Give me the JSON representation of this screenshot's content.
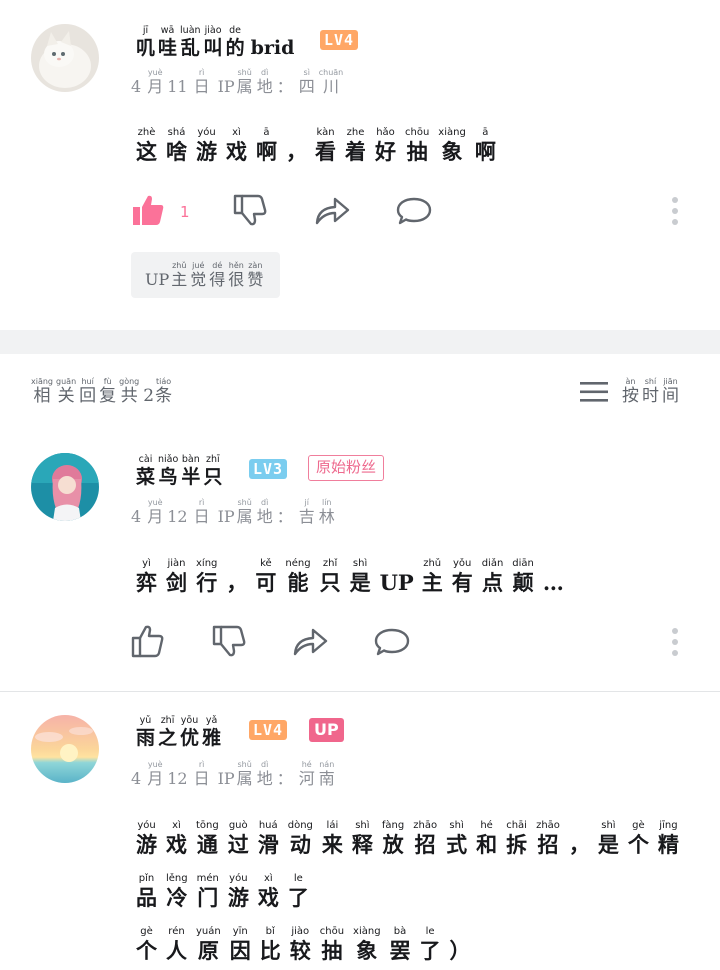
{
  "comment1": {
    "username": {
      "chars": [
        {
          "py": "jī",
          "hz": "叽"
        },
        {
          "py": "wā",
          "hz": "哇"
        },
        {
          "py": "luàn",
          "hz": "乱"
        },
        {
          "py": "jiào",
          "hz": "叫"
        },
        {
          "py": "de",
          "hz": "的"
        }
      ],
      "suffix": "brid"
    },
    "level": "LV4",
    "level_color": "#ff9f5f",
    "meta": {
      "month": [
        {
          "py": "",
          "hz": "4"
        },
        {
          "py": "yuè",
          "hz": "月"
        },
        {
          "py": "",
          "hz": "11"
        },
        {
          "py": "rì",
          "hz": "日"
        }
      ],
      "ip": "IP",
      "loc": [
        {
          "py": "shǔ",
          "hz": "属"
        },
        {
          "py": "dì",
          "hz": "地"
        },
        {
          "py": "",
          "hz": "："
        },
        {
          "py": "sì",
          "hz": "四"
        },
        {
          "py": "chuān",
          "hz": "川"
        }
      ]
    },
    "content": [
      {
        "py": "zhè",
        "hz": "这"
      },
      {
        "py": "shá",
        "hz": "啥"
      },
      {
        "py": "yóu",
        "hz": "游"
      },
      {
        "py": "xì",
        "hz": "戏"
      },
      {
        "py": "ā",
        "hz": "啊"
      },
      {
        "py": "",
        "hz": "，"
      },
      {
        "py": "kàn",
        "hz": "看"
      },
      {
        "py": "zhe",
        "hz": "着"
      },
      {
        "py": "hǎo",
        "hz": "好"
      },
      {
        "py": "chōu",
        "hz": "抽"
      },
      {
        "py": "xiàng",
        "hz": "象"
      },
      {
        "py": "ā",
        "hz": "啊"
      }
    ],
    "like_count": "1",
    "up_liked": {
      "prefix": "UP",
      "chars": [
        {
          "py": "zhǔ",
          "hz": "主"
        },
        {
          "py": "jué",
          "hz": "觉"
        },
        {
          "py": "dé",
          "hz": "得"
        },
        {
          "py": "hěn",
          "hz": "很"
        },
        {
          "py": "zàn",
          "hz": "赞"
        }
      ]
    }
  },
  "replies_header": {
    "count_label": [
      {
        "py": "xiāng",
        "hz": "相"
      },
      {
        "py": "guān",
        "hz": "关"
      },
      {
        "py": "huí",
        "hz": "回"
      },
      {
        "py": "fù",
        "hz": "复"
      },
      {
        "py": "gòng",
        "hz": "共"
      },
      {
        "py": "",
        "hz": "2"
      },
      {
        "py": "tiáo",
        "hz": "条"
      }
    ],
    "sort_label": [
      {
        "py": "àn",
        "hz": "按"
      },
      {
        "py": "shí",
        "hz": "时"
      },
      {
        "py": "jiān",
        "hz": "间"
      }
    ],
    "sort_icon": "list-icon"
  },
  "reply1": {
    "username": {
      "chars": [
        {
          "py": "cài",
          "hz": "菜"
        },
        {
          "py": "niǎo",
          "hz": "鸟"
        },
        {
          "py": "bàn",
          "hz": "半"
        },
        {
          "py": "zhī",
          "hz": "只"
        }
      ]
    },
    "level": "LV3",
    "level_color": "#7bcdef",
    "fan_badge": "原始粉丝",
    "meta": {
      "month": [
        {
          "py": "",
          "hz": "4"
        },
        {
          "py": "yuè",
          "hz": "月"
        },
        {
          "py": "",
          "hz": "12"
        },
        {
          "py": "rì",
          "hz": "日"
        }
      ],
      "ip": "IP",
      "loc": [
        {
          "py": "shǔ",
          "hz": "属"
        },
        {
          "py": "dì",
          "hz": "地"
        },
        {
          "py": "",
          "hz": "："
        },
        {
          "py": "jí",
          "hz": "吉"
        },
        {
          "py": "lín",
          "hz": "林"
        }
      ]
    },
    "content": [
      {
        "py": "yì",
        "hz": "弈"
      },
      {
        "py": "jiàn",
        "hz": "剑"
      },
      {
        "py": "xíng",
        "hz": "行"
      },
      {
        "py": "",
        "hz": "，"
      },
      {
        "py": "kě",
        "hz": "可"
      },
      {
        "py": "néng",
        "hz": "能"
      },
      {
        "py": "zhǐ",
        "hz": "只"
      },
      {
        "py": "shì",
        "hz": "是"
      },
      {
        "py": "",
        "hz": "UP"
      },
      {
        "py": "zhǔ",
        "hz": "主"
      },
      {
        "py": "yǒu",
        "hz": "有"
      },
      {
        "py": "diǎn",
        "hz": "点"
      },
      {
        "py": "diān",
        "hz": "颠"
      },
      {
        "py": "",
        "hz": "…"
      }
    ]
  },
  "reply2": {
    "username": {
      "chars": [
        {
          "py": "yǔ",
          "hz": "雨"
        },
        {
          "py": "zhī",
          "hz": "之"
        },
        {
          "py": "yōu",
          "hz": "优"
        },
        {
          "py": "yǎ",
          "hz": "雅"
        }
      ]
    },
    "level": "LV4",
    "level_color": "#ff9f5f",
    "up_badge": "UP",
    "meta": {
      "month": [
        {
          "py": "",
          "hz": "4"
        },
        {
          "py": "yuè",
          "hz": "月"
        },
        {
          "py": "",
          "hz": "12"
        },
        {
          "py": "rì",
          "hz": "日"
        }
      ],
      "ip": "IP",
      "loc": [
        {
          "py": "shǔ",
          "hz": "属"
        },
        {
          "py": "dì",
          "hz": "地"
        },
        {
          "py": "",
          "hz": "："
        },
        {
          "py": "hé",
          "hz": "河"
        },
        {
          "py": "nán",
          "hz": "南"
        }
      ]
    },
    "content_lines": [
      [
        {
          "py": "yóu",
          "hz": "游"
        },
        {
          "py": "xì",
          "hz": "戏"
        },
        {
          "py": "tōng",
          "hz": "通"
        },
        {
          "py": "guò",
          "hz": "过"
        },
        {
          "py": "huá",
          "hz": "滑"
        },
        {
          "py": "dòng",
          "hz": "动"
        },
        {
          "py": "lái",
          "hz": "来"
        },
        {
          "py": "shì",
          "hz": "释"
        },
        {
          "py": "fàng",
          "hz": "放"
        },
        {
          "py": "zhāo",
          "hz": "招"
        },
        {
          "py": "shì",
          "hz": "式"
        },
        {
          "py": "hé",
          "hz": "和"
        },
        {
          "py": "chāi",
          "hz": "拆"
        },
        {
          "py": "zhāo",
          "hz": "招"
        },
        {
          "py": "",
          "hz": "，"
        },
        {
          "py": "shì",
          "hz": "是"
        },
        {
          "py": "gè",
          "hz": "个"
        },
        {
          "py": "jīng",
          "hz": "精"
        }
      ],
      [
        {
          "py": "pǐn",
          "hz": "品"
        },
        {
          "py": "lěng",
          "hz": "冷"
        },
        {
          "py": "mén",
          "hz": "门"
        },
        {
          "py": "yóu",
          "hz": "游"
        },
        {
          "py": "xì",
          "hz": "戏"
        },
        {
          "py": "le",
          "hz": "了"
        }
      ],
      [
        {
          "py": "gè",
          "hz": "个"
        },
        {
          "py": "rén",
          "hz": "人"
        },
        {
          "py": "yuán",
          "hz": "原"
        },
        {
          "py": "yīn",
          "hz": "因"
        },
        {
          "py": "bǐ",
          "hz": "比"
        },
        {
          "py": "jiào",
          "hz": "较"
        },
        {
          "py": "chōu",
          "hz": "抽"
        },
        {
          "py": "xiàng",
          "hz": "象"
        },
        {
          "py": "bà",
          "hz": "罢"
        },
        {
          "py": "le",
          "hz": "了"
        },
        {
          "py": "",
          "hz": "）"
        }
      ]
    ]
  },
  "colors": {
    "accent": "#fb7299",
    "icon": "#61666d",
    "divider": "#e3e5e7"
  }
}
